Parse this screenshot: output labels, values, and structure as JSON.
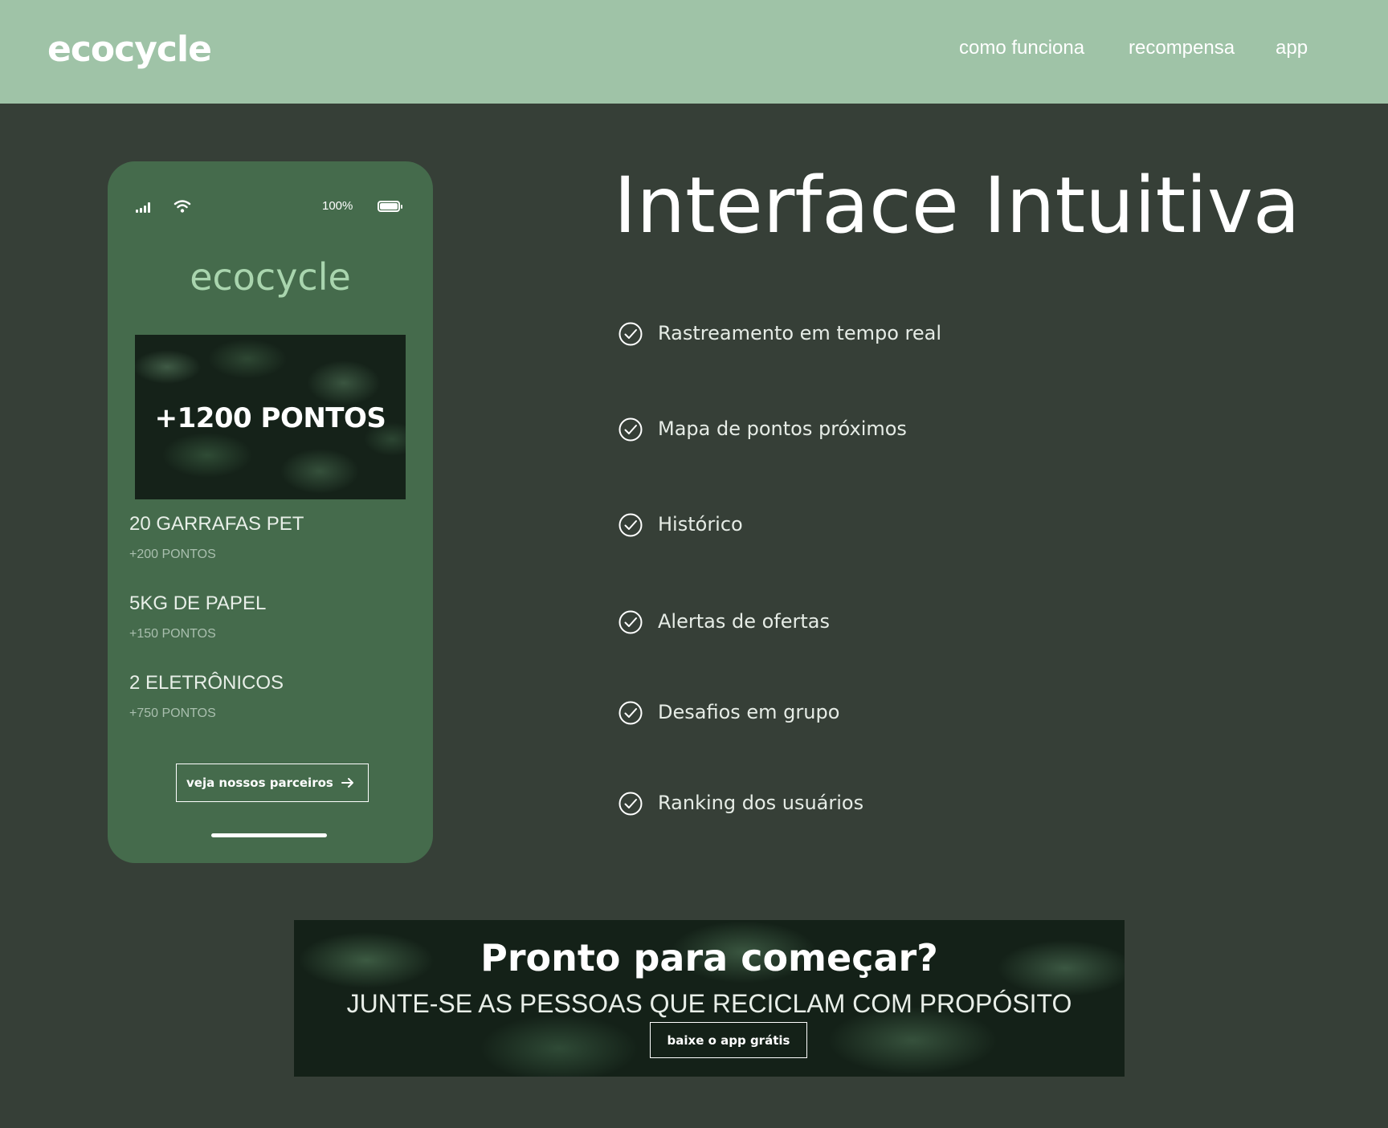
{
  "header": {
    "logo": "ecocycle",
    "nav": [
      "como funciona",
      "recompensa",
      "app"
    ]
  },
  "phone": {
    "battery_text": "100%",
    "app_logo": "ecocycle",
    "promo": "+1200 PONTOS",
    "items": [
      {
        "title": "20 GARRAFAS PET",
        "points": "+200 PONTOS"
      },
      {
        "title": "5KG DE PAPEL",
        "points": "+150 PONTOS"
      },
      {
        "title": "2 ELETRÔNICOS",
        "points": "+750 PONTOS"
      }
    ],
    "button": "veja nossos parceiros"
  },
  "features": {
    "title": "Interface Intuitiva",
    "items": [
      "Rastreamento em tempo real",
      "Mapa de pontos próximos",
      "Histórico",
      "Alertas de ofertas",
      "Desafios em grupo",
      "Ranking dos usuários"
    ]
  },
  "cta": {
    "title": "Pronto para começar?",
    "subtitle": "JUNTE-SE AS PESSOAS QUE RECICLAM COM PROPÓSITO",
    "button": "baixe o app grátis"
  },
  "colors": {
    "header_bg": "#9fc3a7",
    "page_bg": "#363f37",
    "phone_bg": "#456b4c",
    "app_logo": "#a9d5ae"
  },
  "icons": [
    "signal-icon",
    "wifi-icon",
    "battery-icon",
    "arrow-right-icon",
    "check-circle-icon"
  ]
}
